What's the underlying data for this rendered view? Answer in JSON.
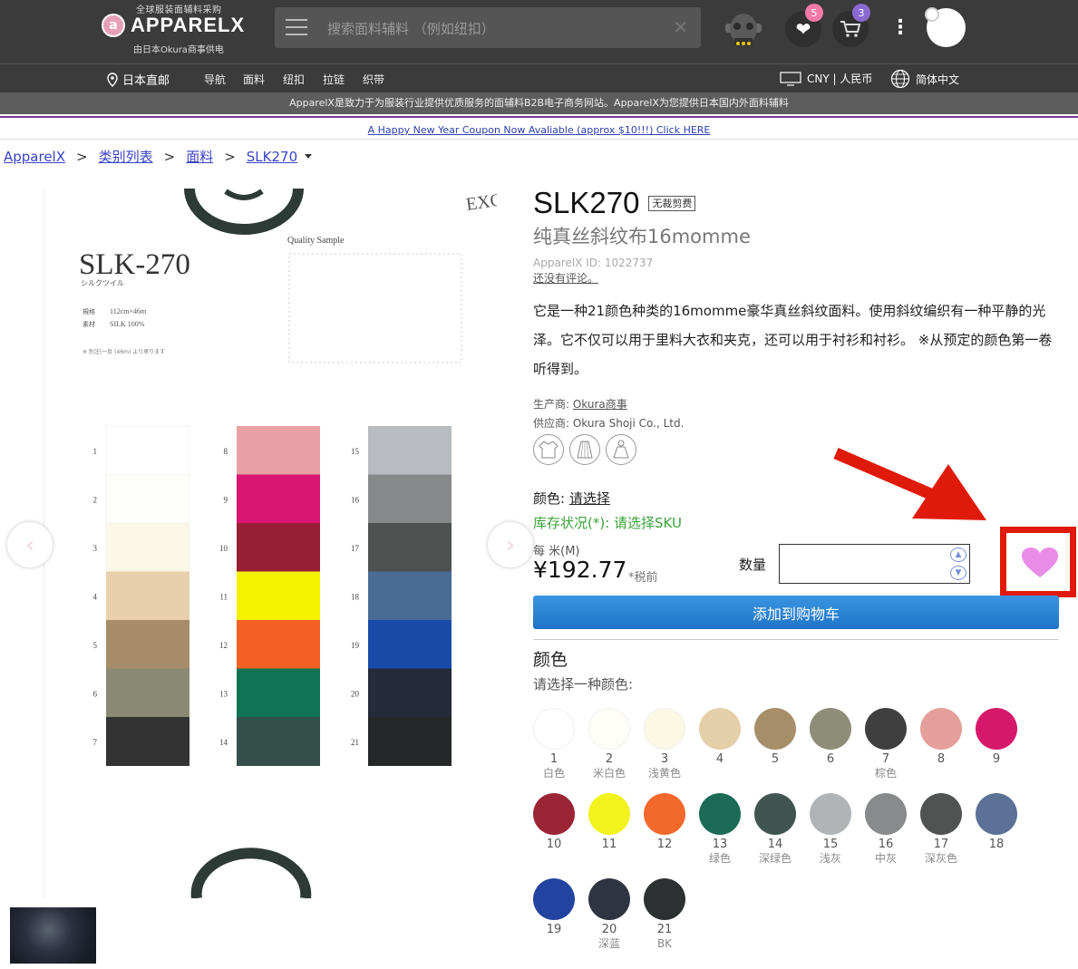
{
  "header": {
    "tagline": "全球服装面辅料采购",
    "brand": "APPARELX",
    "subtitle": "由日本Okura商事供电",
    "search_placeholder": "搜索面料辅料 （例如纽扣）",
    "favorites_count": "5",
    "cart_count": "3"
  },
  "nav": {
    "location": "日本直邮",
    "links": [
      "导航",
      "面料",
      "纽扣",
      "拉链",
      "织带"
    ],
    "currency": "CNY | 人民币",
    "language": "简体中文"
  },
  "info_text": "ApparelX是致力于为服装行业提供优质服务的面辅料B2B电子商务网站。ApparelX为您提供日本国内外面料辅料",
  "coupon_text": "A Happy New Year Coupon Now Avaliable (approx $10!!!) Click HERE",
  "breadcrumb": [
    "ApparelX",
    "类别列表",
    "面料",
    "SLK270"
  ],
  "sample_card": {
    "code": "SLK-270",
    "kana": "シルクツイル",
    "quality": "Quality Sample",
    "spec_label": "規格",
    "spec_value": "112cm×46m",
    "material_label": "素材",
    "material_value": "SILK 100%",
    "note": "※ 別注(一反 (46m) より承ります"
  },
  "product": {
    "title": "SLK270",
    "cut_badge": "无裁剪费",
    "subtitle": "纯真丝斜纹布16momme",
    "id_text": "ApparelX ID: 1022737",
    "review_text": "还没有评论。",
    "description": "它是一种21颜色种类的16momme豪华真丝斜纹面料。使用斜纹编织有一种平静的光泽。它不仅可以用于里料大衣和夹克，还可以用于衬衫和衬衫。 ※从预定的颜色第一卷听得到。",
    "manufacturer_label": "生产商: ",
    "manufacturer": "Okura商事",
    "supplier": "供应商: Okura Shoji Co., Ltd.",
    "color_label": "颜色: ",
    "color_select": "请选择",
    "stock_text": "库存状况(*): 请选择SKU",
    "per_unit": "每 米(M)",
    "price": "¥192.77",
    "tax": "*税前",
    "qty_label": "数量",
    "add_to_cart": "添加到购物车",
    "colors_heading": "颜色",
    "colors_prompt": "请选择一种颜色:"
  },
  "swatches": [
    {
      "num": "1",
      "name": "白色",
      "color": "#ffffff"
    },
    {
      "num": "2",
      "name": "米白色",
      "color": "#fefdf8"
    },
    {
      "num": "3",
      "name": "浅黄色",
      "color": "#fbf8e3"
    },
    {
      "num": "4",
      "name": "",
      "color": "#e5cfa8"
    },
    {
      "num": "5",
      "name": "",
      "color": "#a68e69"
    },
    {
      "num": "6",
      "name": "",
      "color": "#8e8e78"
    },
    {
      "num": "7",
      "name": "棕色",
      "color": "#3f3f3f"
    },
    {
      "num": "8",
      "name": "",
      "color": "#e59f9a"
    },
    {
      "num": "9",
      "name": "",
      "color": "#d5186a"
    },
    {
      "num": "10",
      "name": "",
      "color": "#9b2535"
    },
    {
      "num": "11",
      "name": "",
      "color": "#f2f31c"
    },
    {
      "num": "12",
      "name": "",
      "color": "#f2692b"
    },
    {
      "num": "13",
      "name": "绿色",
      "color": "#1b6b56"
    },
    {
      "num": "14",
      "name": "深绿色",
      "color": "#415550"
    },
    {
      "num": "15",
      "name": "浅灰",
      "color": "#b1b4b7"
    },
    {
      "num": "16",
      "name": "中灰",
      "color": "#888a8b"
    },
    {
      "num": "17",
      "name": "深灰色",
      "color": "#505352"
    },
    {
      "num": "18",
      "name": "",
      "color": "#5b7195"
    },
    {
      "num": "19",
      "name": "",
      "color": "#2343a0"
    },
    {
      "num": "20",
      "name": "深蓝",
      "color": "#2f3540"
    },
    {
      "num": "21",
      "name": "BK",
      "color": "#2d3031"
    }
  ],
  "fabric_columns": [
    [
      {
        "n": "1",
        "c": "#ffffff"
      },
      {
        "n": "2",
        "c": "#fdfdfa"
      },
      {
        "n": "3",
        "c": "#faf7e6"
      },
      {
        "n": "4",
        "c": "#e8d0ad"
      },
      {
        "n": "5",
        "c": "#a68c68"
      },
      {
        "n": "6",
        "c": "#8a8a74"
      },
      {
        "n": "7",
        "c": "#333333"
      }
    ],
    [
      {
        "n": "8",
        "c": "#e8a0a4"
      },
      {
        "n": "9",
        "c": "#d91672"
      },
      {
        "n": "10",
        "c": "#981f33"
      },
      {
        "n": "11",
        "c": "#f4f200"
      },
      {
        "n": "12",
        "c": "#f56124"
      },
      {
        "n": "13",
        "c": "#107454"
      },
      {
        "n": "14",
        "c": "#34504b"
      }
    ],
    [
      {
        "n": "15",
        "c": "#b8bcc0"
      },
      {
        "n": "16",
        "c": "#878889"
      },
      {
        "n": "17",
        "c": "#4d514f"
      },
      {
        "n": "18",
        "c": "#4a6b96"
      },
      {
        "n": "19",
        "c": "#1a4aa8"
      },
      {
        "n": "20",
        "c": "#252b3a"
      },
      {
        "n": "21",
        "c": "#252728"
      }
    ]
  ],
  "colors": {
    "accent": "#1f74c8",
    "stock_green": "#3aa33a",
    "highlight_red": "#e01a0a",
    "heart": "#e98ce8"
  }
}
